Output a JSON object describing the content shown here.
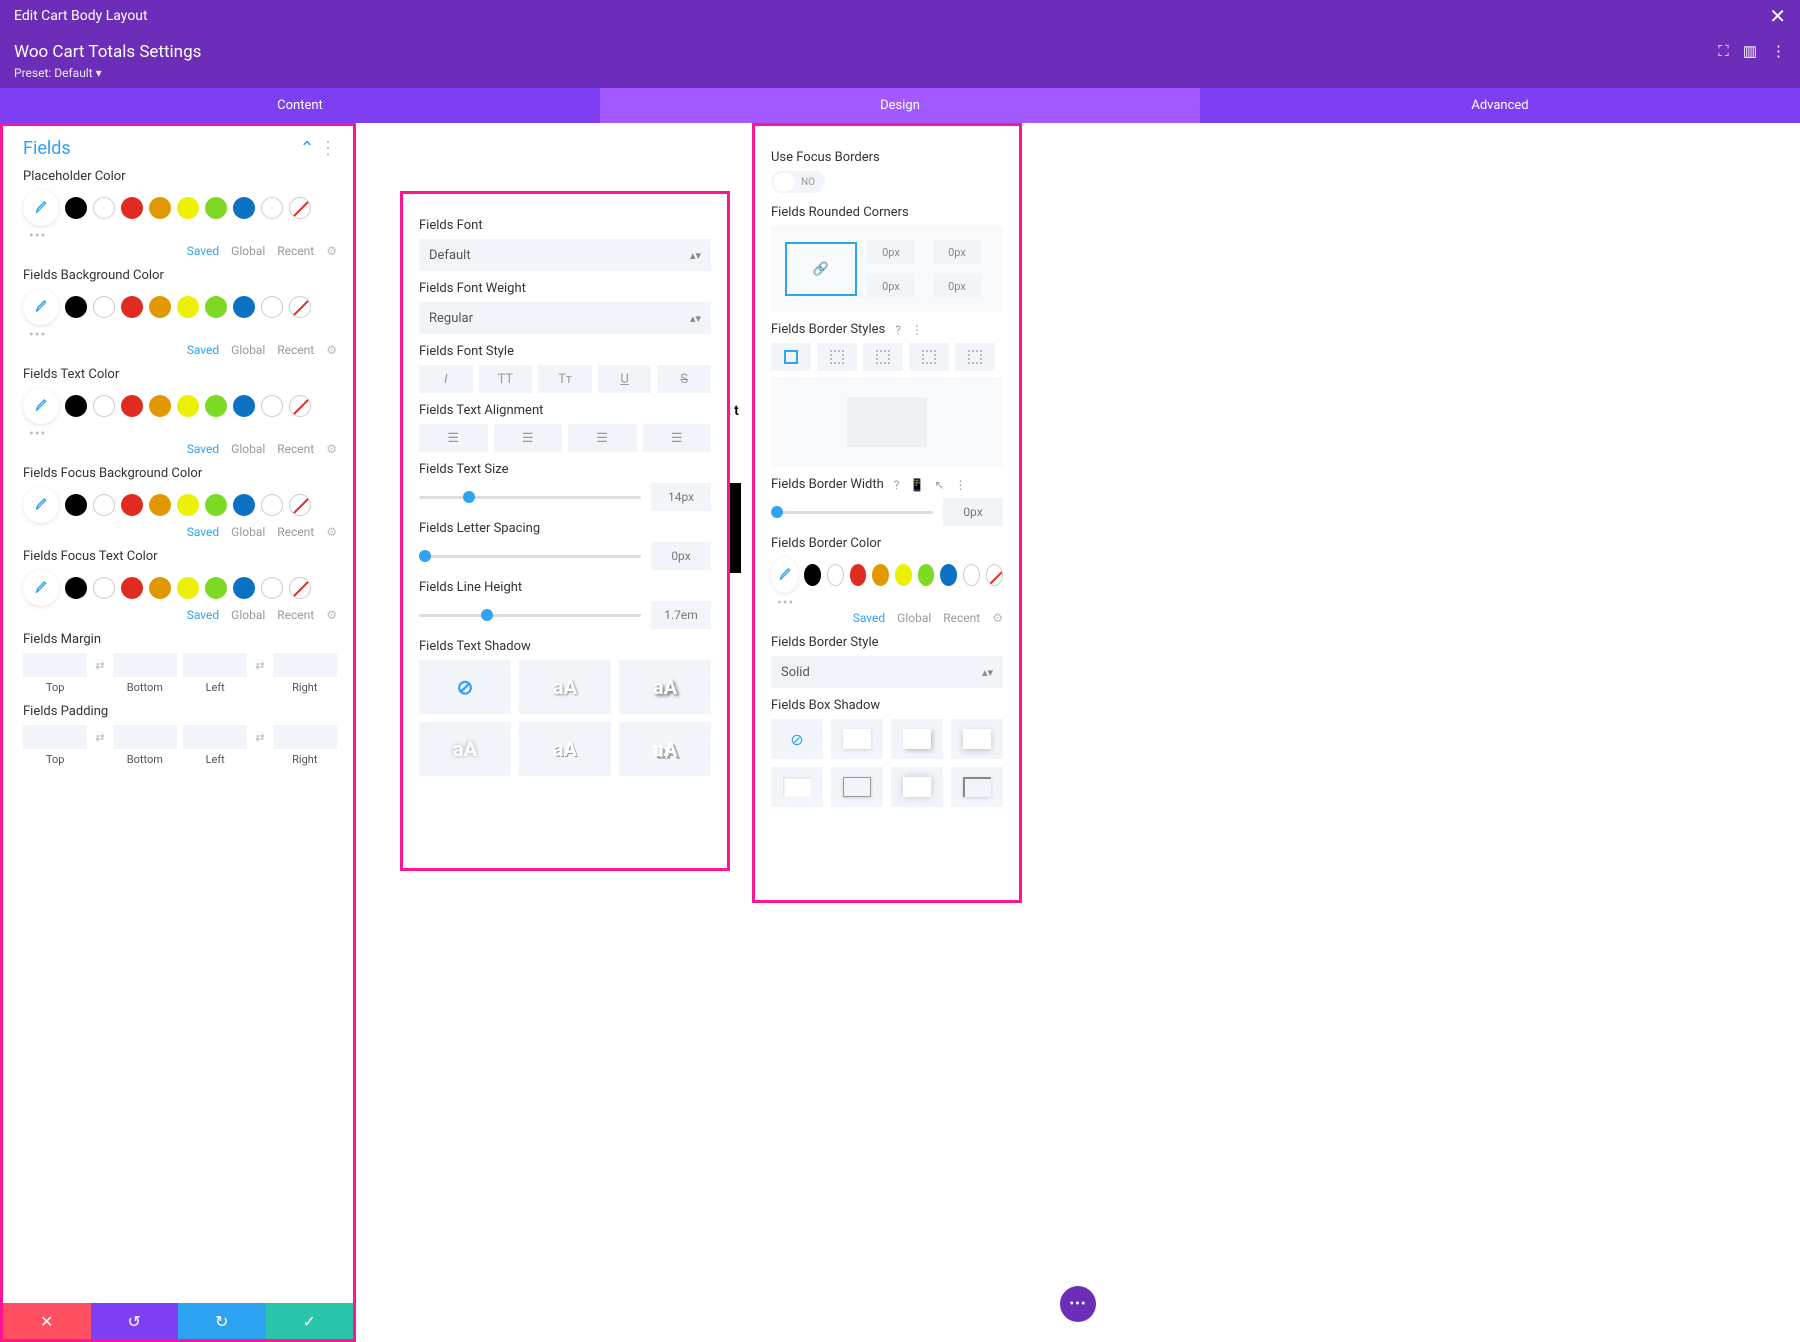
{
  "topbar": {
    "title": "Edit Cart Body Layout"
  },
  "settings": {
    "title": "Woo Cart Totals Settings",
    "preset": "Preset: Default ▾"
  },
  "tabs": {
    "content": "Content",
    "design": "Design",
    "advanced": "Advanced"
  },
  "section": {
    "title": "Fields"
  },
  "colorTabs": {
    "saved": "Saved",
    "global": "Global",
    "recent": "Recent"
  },
  "labels": {
    "placeholder": "Placeholder Color",
    "bg": "Fields Background Color",
    "text": "Fields Text Color",
    "focusbg": "Fields Focus Background Color",
    "focustext": "Fields Focus Text Color",
    "margin": "Fields Margin",
    "padding": "Fields Padding",
    "top": "Top",
    "bottom": "Bottom",
    "left": "Left",
    "right": "Right"
  },
  "mid": {
    "font": "Fields Font",
    "fontDefault": "Default",
    "weight": "Fields Font Weight",
    "weightVal": "Regular",
    "style": "Fields Font Style",
    "align": "Fields Text Alignment",
    "size": "Fields Text Size",
    "sizeVal": "14px",
    "letter": "Fields Letter Spacing",
    "letterVal": "0px",
    "line": "Fields Line Height",
    "lineVal": "1.7em",
    "shadow": "Fields Text Shadow"
  },
  "right": {
    "focus": "Use Focus Borders",
    "no": "NO",
    "rounded": "Fields Rounded Corners",
    "zero": "0px",
    "bstyles": "Fields Border Styles",
    "bwidth": "Fields Border Width",
    "bwidthVal": "0px",
    "bcolor": "Fields Border Color",
    "bstyle": "Fields Border Style",
    "bstyleVal": "Solid",
    "bshadow": "Fields Box Shadow"
  },
  "chart_data": null
}
